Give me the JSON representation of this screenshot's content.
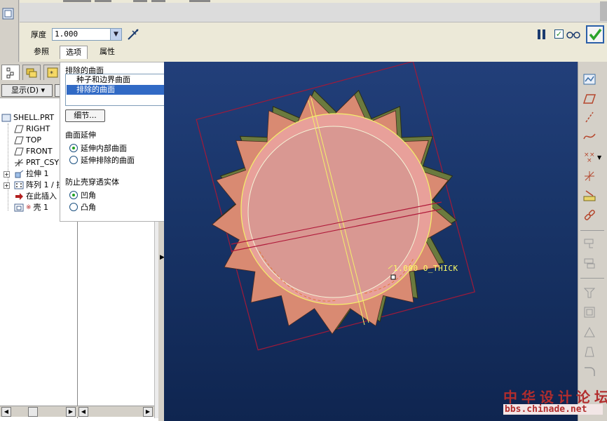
{
  "dashboard": {
    "thickness_label": "厚度",
    "thickness_value": "1.000",
    "tabs": [
      {
        "label": "参照"
      },
      {
        "label": "选项"
      },
      {
        "label": "属性"
      }
    ],
    "preview_checked": true
  },
  "model_tree": {
    "show_button": "显示(D) ▾",
    "items": [
      {
        "label": "SHELL.PRT"
      },
      {
        "label": "RIGHT"
      },
      {
        "label": "TOP"
      },
      {
        "label": "FRONT"
      },
      {
        "label": "PRT_CSYS"
      },
      {
        "label": "拉伸 1"
      },
      {
        "label": "阵列 1 / 拉"
      },
      {
        "label": "在此插入"
      },
      {
        "label": "壳 1"
      }
    ]
  },
  "options_panel": {
    "excluded_surfaces_title": "排除的曲面",
    "list_items": [
      "种子和边界曲面",
      "排除的曲面"
    ],
    "details_button": "细节...",
    "surface_extend_title": "曲面延伸",
    "surface_extend_options": [
      "延伸内部曲面",
      "延伸排除的曲面"
    ],
    "surface_extend_selected": 0,
    "prevent_title": "防止壳穿透实体",
    "prevent_options": [
      "凹角",
      "凸角"
    ],
    "prevent_selected": 0
  },
  "viewport": {
    "dimension_label": "1.000 O_THICK",
    "background": "#193569",
    "model_color": "#cf8a82",
    "datum_color": "#f4f06a"
  },
  "watermark": {
    "line1": "中华设计论坛",
    "line2": "bbs.chinade.net"
  },
  "colors": {
    "accent": "#316ac5",
    "ok_green": "#2aa32a"
  }
}
